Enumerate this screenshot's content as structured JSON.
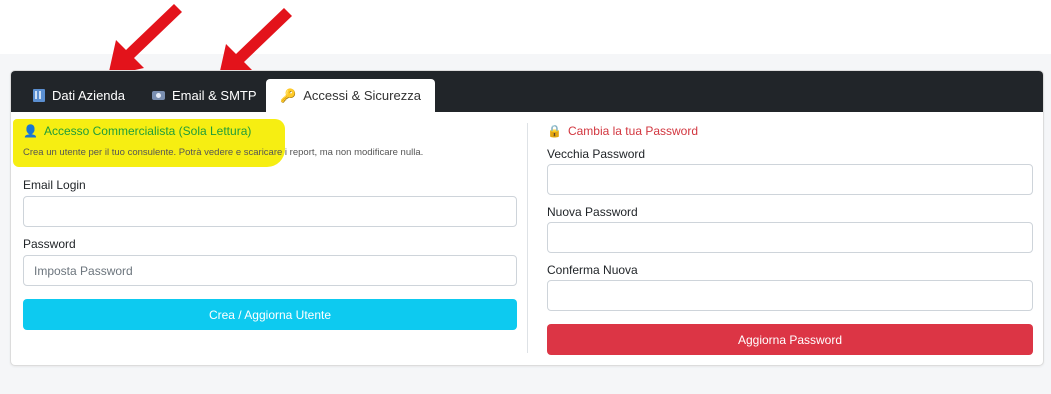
{
  "tabs": [
    {
      "label": "Dati Azienda",
      "icon": "building-icon",
      "active": false
    },
    {
      "label": "Email & SMTP",
      "icon": "mail-icon",
      "active": false
    },
    {
      "label": "Accessi & Sicurezza",
      "icon": "key-icon",
      "active": true
    }
  ],
  "left": {
    "title": "Accesso Commercialista (Sola Lettura)",
    "title_icon": "user-icon",
    "description": "Crea un utente per il tuo consulente. Potrà vedere e scaricare i report, ma non modificare nulla.",
    "email_label": "Email Login",
    "email_value": "",
    "password_label": "Password",
    "password_placeholder": "Imposta Password",
    "submit_label": "Crea / Aggiorna Utente"
  },
  "right": {
    "title": "Cambia la tua Password",
    "title_icon": "lock-icon",
    "old_label": "Vecchia Password",
    "new_label": "Nuova Password",
    "confirm_label": "Conferma Nuova",
    "submit_label": "Aggiorna Password"
  },
  "colors": {
    "accent_cyan": "#0dcaf0",
    "danger_red": "#dc3545",
    "highlight_yellow": "#f6ee12",
    "tabbar_dark": "#212529",
    "annotation_arrow": "#e3131b"
  }
}
